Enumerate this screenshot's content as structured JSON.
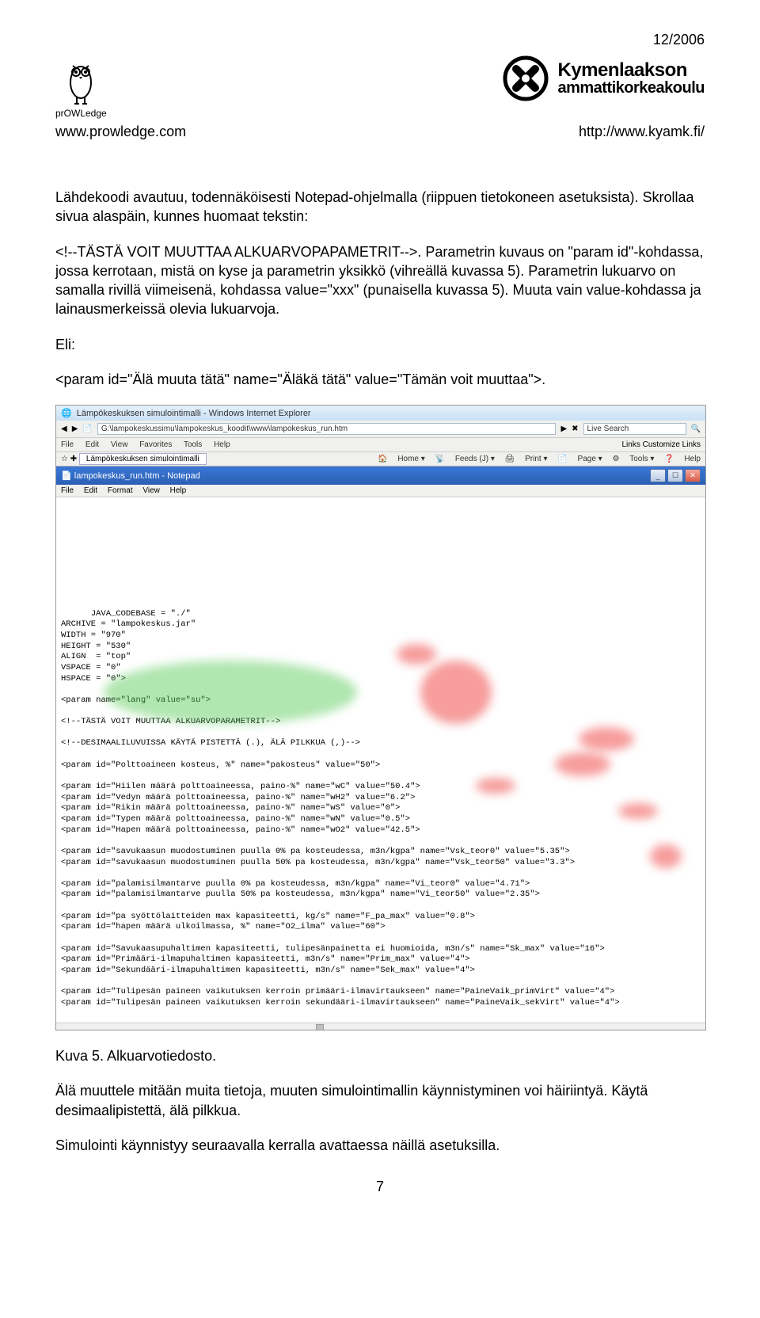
{
  "date": "12/2006",
  "header": {
    "left_brand": "prOWLedge",
    "left_url": "www.prowledge.com",
    "right_top": "Kymenlaakson",
    "right_bottom": "ammattikorkeakoulu",
    "right_url": "http://www.kyamk.fi/"
  },
  "body": {
    "p1": "Lähdekoodi avautuu, todennäköisesti Notepad-ohjelmalla (riippuen tietokoneen asetuksista). Skrollaa sivua alaspäin, kunnes huomaat tekstin:",
    "p2": "<!--TÄSTÄ VOIT MUUTTAA ALKUARVOPAPAMETRIT-->. Parametrin kuvaus on \"param id\"-kohdassa, jossa kerrotaan, mistä on kyse ja parametrin yksikkö (vihreällä kuvassa 5). Parametrin lukuarvo on samalla rivillä viimeisenä, kohdassa value=\"xxx\" (punaisella kuvassa 5). Muuta vain value-kohdassa ja lainausmerkeissä olevia lukuarvoja.",
    "eli": "Eli:",
    "p3": "<param id=\"Älä muuta tätä\" name=\"Äläkä tätä\" value=\"Tämän voit muuttaa\">."
  },
  "screenshot": {
    "ie_title": "Lämpökeskuksen simulointimalli - Windows Internet Explorer",
    "address": "G:\\lampokeskussimu\\lampokeskus_koodit\\www\\lampokeskus_run.htm",
    "live_search": "Live Search",
    "menu": {
      "file": "File",
      "edit": "Edit",
      "view": "View",
      "favorites": "Favorites",
      "tools": "Tools",
      "help": "Help"
    },
    "links_label": "Links",
    "customize": "Customize Links",
    "tab": "Lämpökeskuksen simulointimalli",
    "tb": {
      "home": "Home",
      "feeds": "Feeds (J)",
      "print": "Print",
      "page": "Page",
      "tools": "Tools",
      "help": "Help"
    },
    "np_title": "lampokeskus_run.htm - Notepad",
    "np_menu": {
      "file": "File",
      "edit": "Edit",
      "format": "Format",
      "view": "View",
      "help": "Help"
    },
    "code": "JAVA_CODEBASE = \"./\"\nARCHIVE = \"lampokeskus.jar\"\nWIDTH = \"970\"\nHEIGHT = \"530\"\nALIGN  = \"top\"\nVSPACE = \"0\"\nHSPACE = \"0\">\n\n<param name=\"lang\" value=\"su\">\n\n<!--TÄSTÄ VOIT MUUTTAA ALKUARVOPARAMETRIT-->\n\n<!--DESIMAALILUVUISSA KÄYTÄ PISTETTÄ (.), ÄLÄ PILKKUA (,)-->\n\n<param id=\"Polttoaineen kosteus, %\" name=\"pakosteus\" value=\"50\">\n\n<param id=\"Hiilen määrä polttoaineessa, paino-%\" name=\"wC\" value=\"50.4\">\n<param id=\"Vedyn määrä polttoaineessa, paino-%\" name=\"wH2\" value=\"6.2\">\n<param id=\"Rikin määrä polttoaineessa, paino-%\" name=\"wS\" value=\"0\">\n<param id=\"Typen määrä polttoaineessa, paino-%\" name=\"wN\" value=\"0.5\">\n<param id=\"Hapen määrä polttoaineessa, paino-%\" name=\"wO2\" value=\"42.5\">\n\n<param id=\"savukaasun muodostuminen puulla 0% pa kosteudessa, m3n/kgpa\" name=\"Vsk_teor0\" value=\"5.35\">\n<param id=\"savukaasun muodostuminen puulla 50% pa kosteudessa, m3n/kgpa\" name=\"Vsk_teor50\" value=\"3.3\">\n\n<param id=\"palamisilmantarve puulla 0% pa kosteudessa, m3n/kgpa\" name=\"Vi_teor0\" value=\"4.71\">\n<param id=\"palamisilmantarve puulla 50% pa kosteudessa, m3n/kgpa\" name=\"Vi_teor50\" value=\"2.35\">\n\n<param id=\"pa syöttölaitteiden max kapasiteetti, kg/s\" name=\"F_pa_max\" value=\"0.8\">\n<param id=\"hapen määrä ulkoilmassa, %\" name=\"O2_ilma\" value=\"60\">\n\n<param id=\"Savukaasupuhaltimen kapasiteetti, tulipesänpainetta ei huomioida, m3n/s\" name=\"Sk_max\" value=\"16\">\n<param id=\"Primääri-ilmapuhaltimen kapasiteetti, m3n/s\" name=\"Prim_max\" value=\"4\">\n<param id=\"Sekundääri-ilmapuhaltimen kapasiteetti, m3n/s\" name=\"Sek_max\" value=\"4\">\n\n<param id=\"Tulipesän paineen vaikutuksen kerroin primääri-ilmavirtaukseen\" name=\"PaineVaik_primVirt\" value=\"4\">\n<param id=\"Tulipesän paineen vaikutuksen kerroin sekundääri-ilmavirtaukseen\" name=\"PaineVaik_sekVirt\" value=\"4\">"
  },
  "caption": "Kuva 5. Alkuarvotiedosto.",
  "p4": "Älä muuttele mitään muita tietoja, muuten simulointimallin käynnistyminen voi häiriintyä. Käytä desimaalipistettä, älä pilkkua.",
  "p5": "Simulointi käynnistyy seuraavalla kerralla avattaessa näillä asetuksilla.",
  "page_number": "7"
}
